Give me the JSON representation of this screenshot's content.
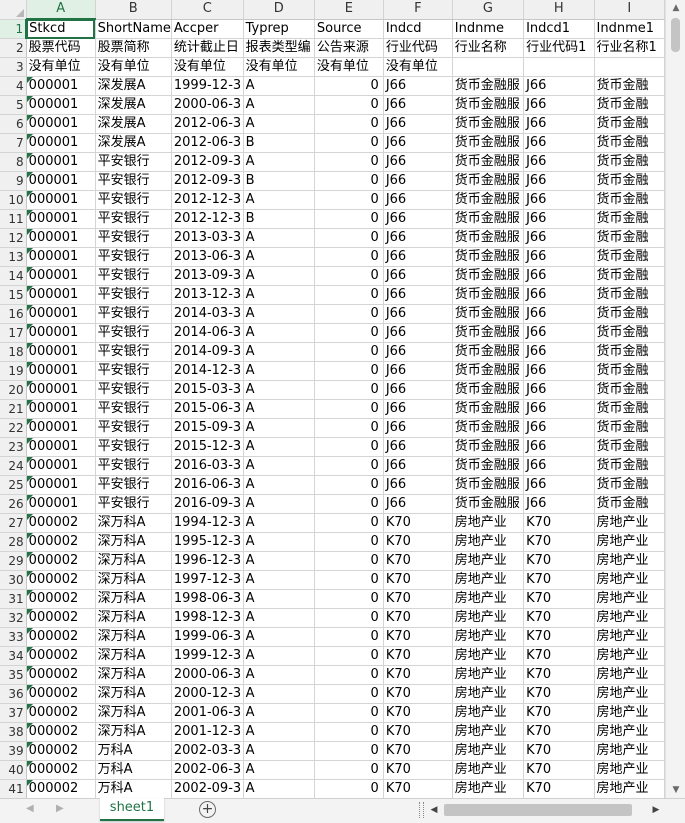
{
  "columns": [
    "A",
    "B",
    "C",
    "D",
    "E",
    "F",
    "G",
    "H",
    "I"
  ],
  "header_rows": [
    [
      "Stkcd",
      "ShortName",
      "Accper",
      "Typrep",
      "Source",
      "Indcd",
      "Indnme",
      "Indcd1",
      "Indnme1"
    ],
    [
      "股票代码",
      "股票简称",
      "统计截止日",
      "报表类型编",
      "公告来源",
      "行业代码",
      "行业名称",
      "行业代码1",
      "行业名称1"
    ],
    [
      "没有单位",
      "没有单位",
      "没有单位",
      "没有单位",
      "没有单位",
      "没有单位",
      "",
      "",
      ""
    ]
  ],
  "data_rows": [
    [
      "000001",
      "深发展A",
      "1999-12-3",
      "A",
      "0",
      "J66",
      "货币金融服",
      "J66",
      "货币金融"
    ],
    [
      "000001",
      "深发展A",
      "2000-06-3",
      "A",
      "0",
      "J66",
      "货币金融服",
      "J66",
      "货币金融"
    ],
    [
      "000001",
      "深发展A",
      "2012-06-3",
      "A",
      "0",
      "J66",
      "货币金融服",
      "J66",
      "货币金融"
    ],
    [
      "000001",
      "深发展A",
      "2012-06-3",
      "B",
      "0",
      "J66",
      "货币金融服",
      "J66",
      "货币金融"
    ],
    [
      "000001",
      "平安银行",
      "2012-09-3",
      "A",
      "0",
      "J66",
      "货币金融服",
      "J66",
      "货币金融"
    ],
    [
      "000001",
      "平安银行",
      "2012-09-3",
      "B",
      "0",
      "J66",
      "货币金融服",
      "J66",
      "货币金融"
    ],
    [
      "000001",
      "平安银行",
      "2012-12-3",
      "A",
      "0",
      "J66",
      "货币金融服",
      "J66",
      "货币金融"
    ],
    [
      "000001",
      "平安银行",
      "2012-12-3",
      "B",
      "0",
      "J66",
      "货币金融服",
      "J66",
      "货币金融"
    ],
    [
      "000001",
      "平安银行",
      "2013-03-3",
      "A",
      "0",
      "J66",
      "货币金融服",
      "J66",
      "货币金融"
    ],
    [
      "000001",
      "平安银行",
      "2013-06-3",
      "A",
      "0",
      "J66",
      "货币金融服",
      "J66",
      "货币金融"
    ],
    [
      "000001",
      "平安银行",
      "2013-09-3",
      "A",
      "0",
      "J66",
      "货币金融服",
      "J66",
      "货币金融"
    ],
    [
      "000001",
      "平安银行",
      "2013-12-3",
      "A",
      "0",
      "J66",
      "货币金融服",
      "J66",
      "货币金融"
    ],
    [
      "000001",
      "平安银行",
      "2014-03-3",
      "A",
      "0",
      "J66",
      "货币金融服",
      "J66",
      "货币金融"
    ],
    [
      "000001",
      "平安银行",
      "2014-06-3",
      "A",
      "0",
      "J66",
      "货币金融服",
      "J66",
      "货币金融"
    ],
    [
      "000001",
      "平安银行",
      "2014-09-3",
      "A",
      "0",
      "J66",
      "货币金融服",
      "J66",
      "货币金融"
    ],
    [
      "000001",
      "平安银行",
      "2014-12-3",
      "A",
      "0",
      "J66",
      "货币金融服",
      "J66",
      "货币金融"
    ],
    [
      "000001",
      "平安银行",
      "2015-03-3",
      "A",
      "0",
      "J66",
      "货币金融服",
      "J66",
      "货币金融"
    ],
    [
      "000001",
      "平安银行",
      "2015-06-3",
      "A",
      "0",
      "J66",
      "货币金融服",
      "J66",
      "货币金融"
    ],
    [
      "000001",
      "平安银行",
      "2015-09-3",
      "A",
      "0",
      "J66",
      "货币金融服",
      "J66",
      "货币金融"
    ],
    [
      "000001",
      "平安银行",
      "2015-12-3",
      "A",
      "0",
      "J66",
      "货币金融服",
      "J66",
      "货币金融"
    ],
    [
      "000001",
      "平安银行",
      "2016-03-3",
      "A",
      "0",
      "J66",
      "货币金融服",
      "J66",
      "货币金融"
    ],
    [
      "000001",
      "平安银行",
      "2016-06-3",
      "A",
      "0",
      "J66",
      "货币金融服",
      "J66",
      "货币金融"
    ],
    [
      "000001",
      "平安银行",
      "2016-09-3",
      "A",
      "0",
      "J66",
      "货币金融服",
      "J66",
      "货币金融"
    ],
    [
      "000002",
      "深万科A",
      "1994-12-3",
      "A",
      "0",
      "K70",
      "房地产业",
      "K70",
      "房地产业"
    ],
    [
      "000002",
      "深万科A",
      "1995-12-3",
      "A",
      "0",
      "K70",
      "房地产业",
      "K70",
      "房地产业"
    ],
    [
      "000002",
      "深万科A",
      "1996-12-3",
      "A",
      "0",
      "K70",
      "房地产业",
      "K70",
      "房地产业"
    ],
    [
      "000002",
      "深万科A",
      "1997-12-3",
      "A",
      "0",
      "K70",
      "房地产业",
      "K70",
      "房地产业"
    ],
    [
      "000002",
      "深万科A",
      "1998-06-3",
      "A",
      "0",
      "K70",
      "房地产业",
      "K70",
      "房地产业"
    ],
    [
      "000002",
      "深万科A",
      "1998-12-3",
      "A",
      "0",
      "K70",
      "房地产业",
      "K70",
      "房地产业"
    ],
    [
      "000002",
      "深万科A",
      "1999-06-3",
      "A",
      "0",
      "K70",
      "房地产业",
      "K70",
      "房地产业"
    ],
    [
      "000002",
      "深万科A",
      "1999-12-3",
      "A",
      "0",
      "K70",
      "房地产业",
      "K70",
      "房地产业"
    ],
    [
      "000002",
      "深万科A",
      "2000-06-3",
      "A",
      "0",
      "K70",
      "房地产业",
      "K70",
      "房地产业"
    ],
    [
      "000002",
      "深万科A",
      "2000-12-3",
      "A",
      "0",
      "K70",
      "房地产业",
      "K70",
      "房地产业"
    ],
    [
      "000002",
      "深万科A",
      "2001-06-3",
      "A",
      "0",
      "K70",
      "房地产业",
      "K70",
      "房地产业"
    ],
    [
      "000002",
      "深万科A",
      "2001-12-3",
      "A",
      "0",
      "K70",
      "房地产业",
      "K70",
      "房地产业"
    ],
    [
      "000002",
      "万科A",
      "2002-03-3",
      "A",
      "0",
      "K70",
      "房地产业",
      "K70",
      "房地产业"
    ],
    [
      "000002",
      "万科A",
      "2002-06-3",
      "A",
      "0",
      "K70",
      "房地产业",
      "K70",
      "房地产业"
    ],
    [
      "000002",
      "万科A",
      "2002-09-3",
      "A",
      "0",
      "K70",
      "房地产业",
      "K70",
      "房地产业"
    ]
  ],
  "sheet_tab": "sheet1",
  "icons": {
    "add_sheet": "plus-circle-icon",
    "scroll_left": "triangle-left-icon",
    "scroll_right": "triangle-right-icon",
    "scroll_up": "triangle-up-icon",
    "scroll_down": "triangle-down-icon"
  },
  "glyphs": {
    "up": "▲",
    "down": "▼",
    "left": "◀",
    "right": "▶",
    "plus": "+"
  },
  "colors": {
    "accent": "#217346",
    "header_bg": "#f0f0f0",
    "grid": "#d4d4d4"
  }
}
